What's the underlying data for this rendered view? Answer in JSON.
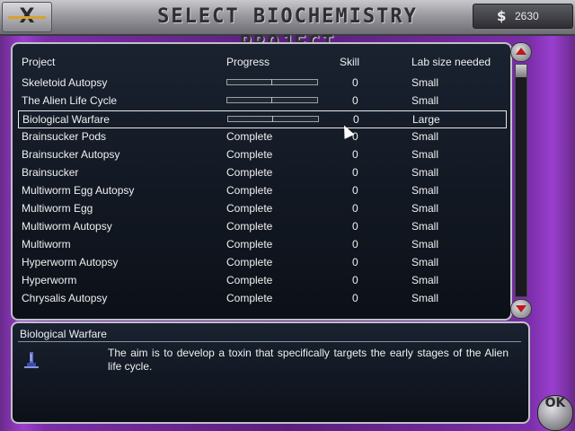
{
  "header": {
    "title": "SELECT BIOCHEMISTRY PROJECT",
    "money_icon": "$",
    "money": "2630",
    "logo_text": "X"
  },
  "table": {
    "columns": [
      "Project",
      "Progress",
      "Skill",
      "Lab size needed"
    ],
    "rows": [
      {
        "project": "Skeletoid Autopsy",
        "progress": "",
        "progress_fraction": 0.0,
        "skill": "0",
        "lab": "Small"
      },
      {
        "project": "The Alien Life Cycle",
        "progress": "",
        "progress_fraction": 0.0,
        "skill": "0",
        "lab": "Small"
      },
      {
        "project": "Biological Warfare",
        "progress": "",
        "progress_fraction": 0.0,
        "skill": "0",
        "lab": "Large"
      },
      {
        "project": "Brainsucker Pods",
        "progress": "Complete",
        "skill": "0",
        "lab": "Small"
      },
      {
        "project": "Brainsucker Autopsy",
        "progress": "Complete",
        "skill": "0",
        "lab": "Small"
      },
      {
        "project": "Brainsucker",
        "progress": "Complete",
        "skill": "0",
        "lab": "Small"
      },
      {
        "project": "Multiworm Egg Autopsy",
        "progress": "Complete",
        "skill": "0",
        "lab": "Small"
      },
      {
        "project": "Multiworm Egg",
        "progress": "Complete",
        "skill": "0",
        "lab": "Small"
      },
      {
        "project": "Multiworm Autopsy",
        "progress": "Complete",
        "skill": "0",
        "lab": "Small"
      },
      {
        "project": "Multiworm",
        "progress": "Complete",
        "skill": "0",
        "lab": "Small"
      },
      {
        "project": "Hyperworm Autopsy",
        "progress": "Complete",
        "skill": "0",
        "lab": "Small"
      },
      {
        "project": "Hyperworm",
        "progress": "Complete",
        "skill": "0",
        "lab": "Small"
      },
      {
        "project": "Chrysalis Autopsy",
        "progress": "Complete",
        "skill": "0",
        "lab": "Small"
      }
    ],
    "selected_index": 2
  },
  "description": {
    "title": "Biological Warfare",
    "text": "The aim is to develop a toxin that specifically targets the early stages of the Alien life cycle."
  },
  "buttons": {
    "ok": "OK"
  },
  "icons": {
    "scroll_up": "scroll-up-arrow-icon",
    "scroll_down": "scroll-down-arrow-icon",
    "research": "test-tube-icon"
  },
  "colors": {
    "frame": "#7a2ea8",
    "accent_arrow": "#c01818",
    "text": "#f0f0f0"
  }
}
